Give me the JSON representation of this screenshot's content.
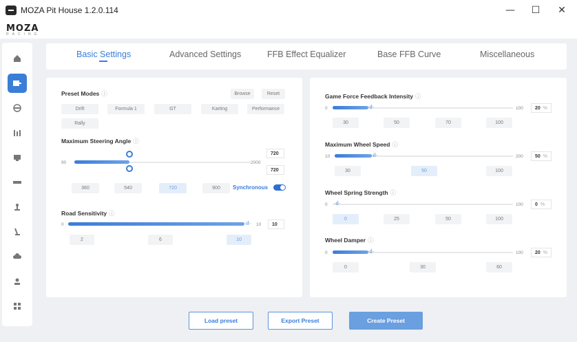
{
  "window": {
    "title": "MOZA Pit House 1.2.0.114",
    "minimize": "—",
    "maximize": "☐",
    "close": "✕"
  },
  "brand": {
    "name": "MOZA",
    "sub": "RACING"
  },
  "tabs": [
    {
      "label": "Basic Settings",
      "active": true
    },
    {
      "label": "Advanced Settings",
      "active": false
    },
    {
      "label": "FFB Effect Equalizer",
      "active": false
    },
    {
      "label": "Base FFB Curve",
      "active": false
    },
    {
      "label": "Miscellaneous",
      "active": false
    }
  ],
  "sidebar": {
    "items": [
      {
        "icon": "home-icon"
      },
      {
        "icon": "wheelbase-icon",
        "active": true
      },
      {
        "icon": "steering-wheel-icon"
      },
      {
        "icon": "pedals-icon"
      },
      {
        "icon": "dashboard-icon"
      },
      {
        "icon": "display-icon"
      },
      {
        "icon": "shifter-icon"
      },
      {
        "icon": "handbrake-icon"
      },
      {
        "icon": "cloud-icon"
      },
      {
        "icon": "user-icon"
      },
      {
        "icon": "settings-icon"
      }
    ]
  },
  "left": {
    "preset_modes": {
      "label": "Preset Modes",
      "browse": "Browse",
      "reset": "Reset",
      "modes": [
        "Drift",
        "Formula 1",
        "GT",
        "Karting",
        "Performance",
        "Rally"
      ]
    },
    "steering_angle": {
      "label": "Maximum Steering Angle",
      "min": "90",
      "max": "2000",
      "value_top": "720",
      "value_bottom": "720",
      "chips": [
        "360",
        "540",
        "720",
        "900"
      ],
      "selected": "720",
      "synchronous": "Synchronous",
      "fraction": 0.33
    },
    "road_sensitivity": {
      "label": "Road Sensitivity",
      "min": "0",
      "max": "10",
      "value": "10",
      "chips": [
        "2",
        "6",
        "10"
      ],
      "selected": "10",
      "fraction": 1.0
    }
  },
  "right": {
    "ffb_intensity": {
      "label": "Game Force Feedback Intensity",
      "min": "0",
      "max": "100",
      "value": "20",
      "unit": "%",
      "chips": [
        "30",
        "50",
        "70",
        "100"
      ],
      "fraction": 0.2
    },
    "wheel_speed": {
      "label": "Maximum Wheel Speed",
      "min": "10",
      "max": "200",
      "value": "50",
      "unit": "%",
      "chips": [
        "30",
        "50",
        "100"
      ],
      "selected": "50",
      "fraction": 0.21
    },
    "spring_strength": {
      "label": "Wheel Spring Strength",
      "min": "0",
      "max": "100",
      "value": "0",
      "unit": "%",
      "chips": [
        "0",
        "25",
        "50",
        "100"
      ],
      "selected": "0",
      "fraction": 0.0
    },
    "wheel_damper": {
      "label": "Wheel Damper",
      "min": "0",
      "max": "100",
      "value": "20",
      "unit": "%",
      "chips": [
        "0",
        "30",
        "60"
      ],
      "fraction": 0.2
    }
  },
  "footer": {
    "load": "Load preset",
    "export": "Export Preset",
    "create": "Create Preset"
  },
  "colors": {
    "accent": "#3b7dd8"
  }
}
